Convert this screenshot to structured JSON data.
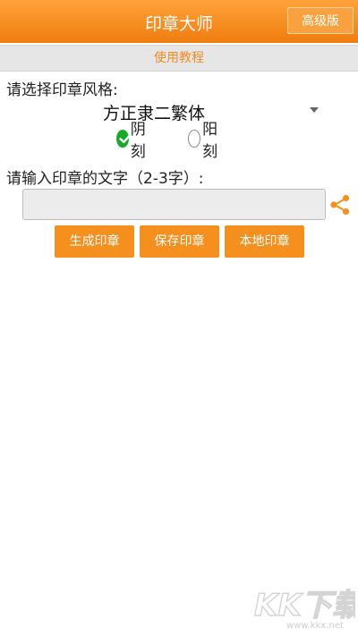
{
  "header": {
    "title": "印章大师",
    "pro_label": "高级版"
  },
  "tutorial": {
    "label": "使用教程"
  },
  "style_section": {
    "label": "请选择印章风格:",
    "selected_font": "方正隶二繁体",
    "radios": [
      {
        "label": "阴刻",
        "checked": true
      },
      {
        "label": "阳刻",
        "checked": false
      }
    ]
  },
  "text_section": {
    "label": "请输入印章的文字（2-3字）:",
    "value": "",
    "placeholder": ""
  },
  "buttons": {
    "generate": "生成印章",
    "save": "保存印章",
    "local": "本地印章"
  },
  "watermark": {
    "logo_text": "KK下载",
    "url": "www.kkx.net"
  },
  "colors": {
    "accent": "#f5901e",
    "check": "#1aaa2b",
    "tutorial_text": "#ef8a1f"
  }
}
